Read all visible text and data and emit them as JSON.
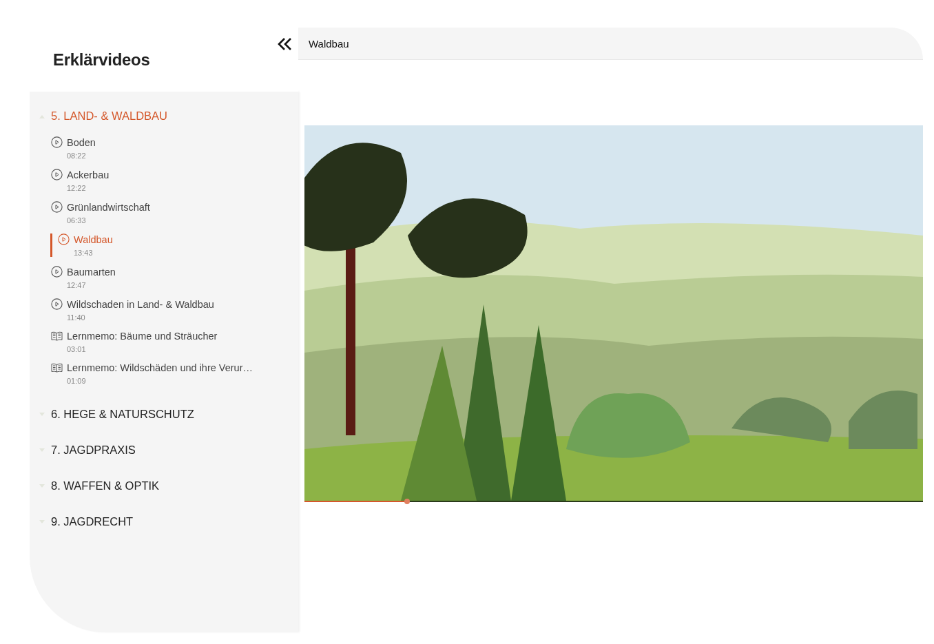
{
  "sidebar": {
    "title": "Erklärvideos",
    "sections": [
      {
        "label": "5. LAND- & WALDBAU",
        "expanded": true,
        "items": [
          {
            "kind": "video",
            "title": "Boden",
            "duration": "08:22",
            "selected": false
          },
          {
            "kind": "video",
            "title": "Ackerbau",
            "duration": "12:22",
            "selected": false
          },
          {
            "kind": "video",
            "title": "Grünlandwirtschaft",
            "duration": "06:33",
            "selected": false
          },
          {
            "kind": "video",
            "title": "Waldbau",
            "duration": "13:43",
            "selected": true
          },
          {
            "kind": "video",
            "title": "Baumarten",
            "duration": "12:47",
            "selected": false
          },
          {
            "kind": "video",
            "title": "Wildschaden in Land- & Waldbau",
            "duration": "11:40",
            "selected": false
          },
          {
            "kind": "memo",
            "title": "Lernmemo: Bäume und Sträucher",
            "duration": "03:01",
            "selected": false
          },
          {
            "kind": "memo",
            "title": "Lernmemo: Wildschäden und ihre Verur…",
            "duration": "01:09",
            "selected": false
          }
        ]
      },
      {
        "label": "6. HEGE & NATURSCHUTZ",
        "expanded": false
      },
      {
        "label": "7. JAGDPRAXIS",
        "expanded": false
      },
      {
        "label": "8. WAFFEN & OPTIK",
        "expanded": false
      },
      {
        "label": "9. JAGDRECHT",
        "expanded": false
      }
    ]
  },
  "player": {
    "title": "Waldbau",
    "progress": {
      "level": 0.166
    }
  }
}
